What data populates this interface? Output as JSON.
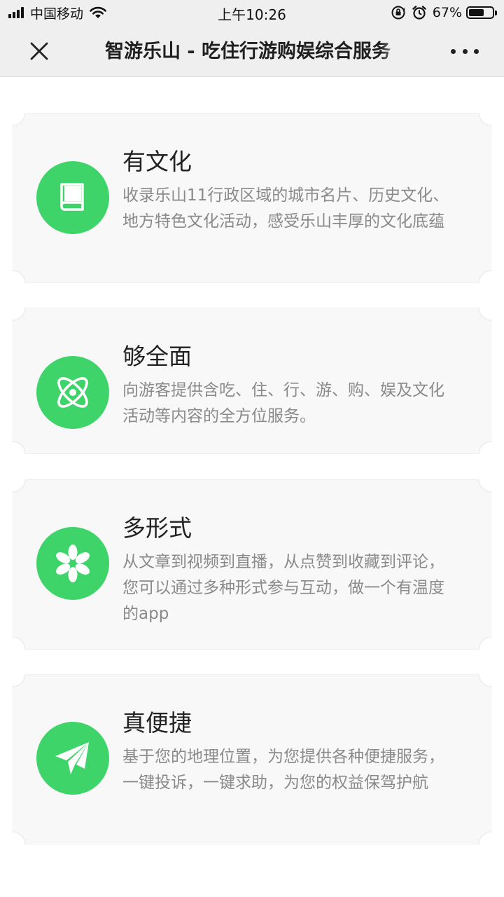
{
  "status_bar": {
    "carrier": "中国移动",
    "time": "上午10:26",
    "battery_percent": "67%",
    "battery_level": 0.67
  },
  "nav": {
    "title": "智游乐山 - 吃住行游购娱综合服务"
  },
  "features": [
    {
      "title": "有文化",
      "description": "收录乐山11行政区域的城市名片、历史文化、地方特色文化活动，感受乐山丰厚的文化底蕴",
      "icon": "book-icon"
    },
    {
      "title": "够全面",
      "description": "向游客提供含吃、住、行、游、购、娱及文化活动等内容的全方位服务。",
      "icon": "atom-icon"
    },
    {
      "title": "多形式",
      "description": "从文章到视频到直播，从点赞到收藏到评论，您可以通过多种形式参与互动，做一个有温度的app",
      "icon": "flower-icon"
    },
    {
      "title": "真便捷",
      "description": "基于您的地理位置，为您提供各种便捷服务，一键投诉，一键求助，为您的权益保驾护航",
      "icon": "paper-plane-icon"
    }
  ],
  "colors": {
    "accent": "#3fd46a",
    "card_bg": "#f8f8f8",
    "card_border": "#ececec",
    "bar_bg": "#efefef"
  }
}
